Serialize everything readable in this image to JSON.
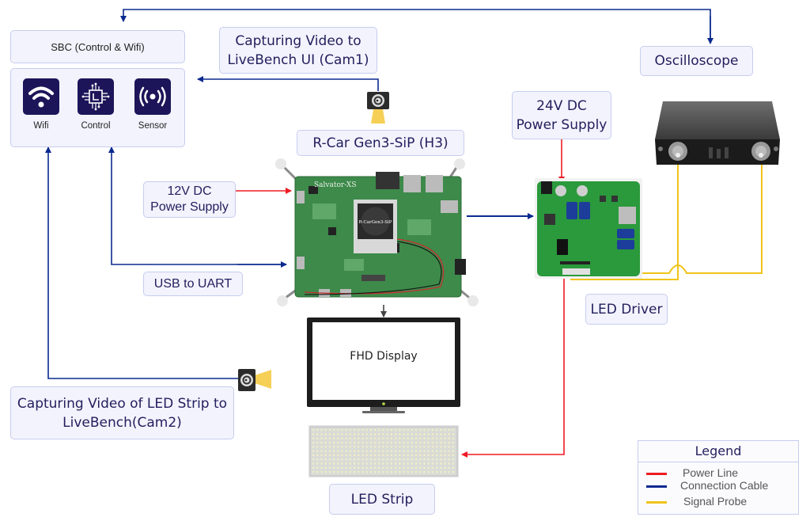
{
  "colors": {
    "power_line": "#ee1b24",
    "connection_cable": "#0b2a8f",
    "signal_probe": "#f0c419",
    "label_bg": "#f3f3fd",
    "label_border": "#c6cdee",
    "label_text": "#23205e",
    "icon_bg": "#1c1559"
  },
  "sbc": {
    "title": "SBC (Control & Wifi)",
    "modules": [
      {
        "icon": "wifi-icon",
        "label": "Wifi"
      },
      {
        "icon": "chip-icon",
        "label": "Control"
      },
      {
        "icon": "sensor-icon",
        "label": "Sensor"
      }
    ]
  },
  "labels": {
    "cam1": "Capturing Video to\nLiveBench UI (Cam1)",
    "board": "R-Car Gen3-SiP (H3)",
    "oscilloscope": "Oscilloscope",
    "psu24": "24V DC\nPower Supply",
    "psu12": "12V DC\nPower Supply",
    "usb_uart": "USB to UART",
    "led_driver": "LED Driver",
    "cam2": "Capturing Video of LED Strip to\nLiveBench(Cam2)",
    "display": "FHD Display",
    "led_strip": "LED Strip"
  },
  "board_image": {
    "silkscreen": "Salvator-XS",
    "chip_label": "R-CarGen3-SiP"
  },
  "legend": {
    "title": "Legend",
    "items": [
      {
        "label": "Power Line",
        "color": "#ee1b24"
      },
      {
        "label": "Connection Cable",
        "color": "#0b2a8f"
      },
      {
        "label": "Signal Probe",
        "color": "#f0c419"
      }
    ]
  }
}
